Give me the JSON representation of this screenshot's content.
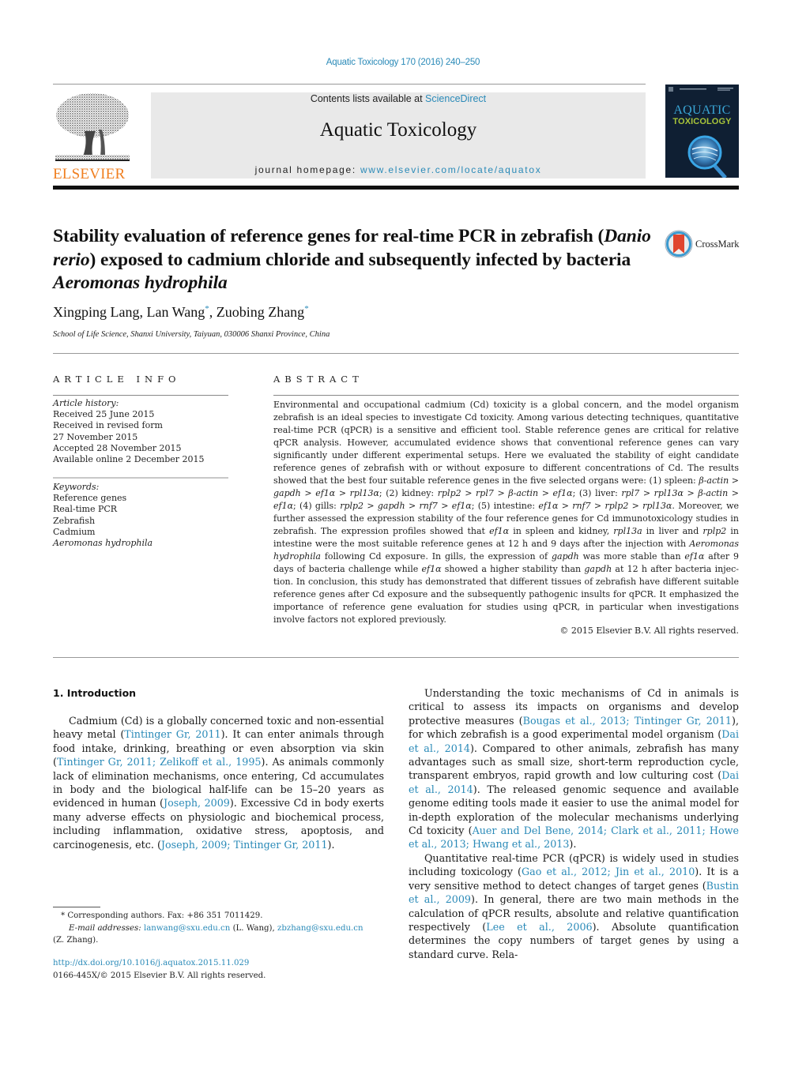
{
  "running_head": "Aquatic Toxicology 170 (2016) 240–250",
  "masthead": {
    "publisher_logo_text": "ELSEVIER",
    "contents_prefix": "Contents lists available at ",
    "contents_link": "ScienceDirect",
    "journal_title": "Aquatic Toxicology",
    "homepage_prefix": "journal homepage: ",
    "homepage_link": "www.elsevier.com/locate/aquatox",
    "cover_title_line1": "AQUATIC",
    "cover_title_line2": "TOXICOLOGY",
    "colors": {
      "link": "#2a8ab8",
      "elsevier_orange": "#f07f20",
      "cover_bg": "#0f1f33",
      "cover_green": "#a7c43a"
    }
  },
  "article": {
    "title_parts": [
      {
        "text": "Stability evaluation of reference genes for real-time PCR in zebrafish (",
        "italic": false
      },
      {
        "text": "Danio rerio",
        "italic": true
      },
      {
        "text": ") exposed to cadmium chloride and subsequently infected by bacteria ",
        "italic": false
      },
      {
        "text": "Aeromonas hydrophila",
        "italic": true
      }
    ],
    "crossmark_label": "CrossMark",
    "authors": [
      {
        "name": "Xingping Lang",
        "corresponding": false
      },
      {
        "name": "Lan Wang",
        "corresponding": true
      },
      {
        "name": "Zuobing Zhang",
        "corresponding": true
      }
    ],
    "affiliation": "School of Life Science, Shanxi University, Taiyuan, 030006 Shanxi Province, China"
  },
  "article_info": {
    "heading": "ARTICLE INFO",
    "history_label": "Article history:",
    "history": [
      "Received 25 June 2015",
      "Received in revised form",
      "27 November 2015",
      "Accepted 28 November 2015",
      "Available online 2 December 2015"
    ],
    "keywords_label": "Keywords:",
    "keywords": [
      {
        "text": "Reference genes",
        "italic": false
      },
      {
        "text": "Real-time PCR",
        "italic": false
      },
      {
        "text": "Zebrafish",
        "italic": false
      },
      {
        "text": "Cadmium",
        "italic": false
      },
      {
        "text": "Aeromonas hydrophila",
        "italic": true
      }
    ]
  },
  "abstract": {
    "heading": "ABSTRACT",
    "parts": [
      {
        "t": "Environmental and occupational cadmium (Cd) toxicity is a global concern, and the model organism zebrafish is an ideal species to investigate Cd toxicity. Among various detecting techniques, quan­titative real-time PCR (qPCR) is a sensitive and efficient tool. Stable reference genes are critical for relative qPCR analysis. However, accumulated evidence shows that conventional reference genes can vary significantly under different experimental setups. Here we evaluated the stability of eight can­didate reference genes of zebrafish with or without exposure to different concentrations of Cd. The results showed that the best four suitable reference genes in the five selected organs were: (1) spleen: "
      },
      {
        "t": "β-actin > gapdh > ef1α > rpl13α",
        "i": true
      },
      {
        "t": "; (2) kidney: "
      },
      {
        "t": "rplp2 > rpl7 > β-actin > ef1α",
        "i": true
      },
      {
        "t": "; (3) liver: "
      },
      {
        "t": "rpl7 > rpl13α > β-actin > ef1α",
        "i": true
      },
      {
        "t": "; (4) gills: "
      },
      {
        "t": "rplp2 > gapdh > rnf7 > ef1α",
        "i": true
      },
      {
        "t": "; (5) intestine: "
      },
      {
        "t": "ef1α > rnf7 > rplp2 > rpl13α",
        "i": true
      },
      {
        "t": ". Moreover, we further assessed the expression stability of the four reference genes for Cd immunotoxicology studies in zebrafish. The expression profiles showed that "
      },
      {
        "t": "ef1α",
        "i": true
      },
      {
        "t": " in spleen and kidney, "
      },
      {
        "t": "rpl13a",
        "i": true
      },
      {
        "t": " in liver and "
      },
      {
        "t": "rplp2",
        "i": true
      },
      {
        "t": " in intestine were the most suitable reference genes at 12 h and 9 days after the injection with "
      },
      {
        "t": "Aeromonas hydrophila",
        "i": true
      },
      {
        "t": " following Cd exposure. In gills, the expression of "
      },
      {
        "t": "gapdh",
        "i": true
      },
      {
        "t": " was more stable than "
      },
      {
        "t": "ef1α",
        "i": true
      },
      {
        "t": " after 9 days of bacteria challenge while "
      },
      {
        "t": "ef1α",
        "i": true
      },
      {
        "t": " showed a higher stability than "
      },
      {
        "t": "gapdh",
        "i": true
      },
      {
        "t": " at 12 h after bacteria injec­tion. In conclusion, this study has demonstrated that different tissues of zebrafish have different suitable reference genes after Cd exposure and the subsequently pathogenic insults for qPCR. It emphasized the importance of reference gene evaluation for studies using qPCR, in particular when investigations involve factors not explored previously."
      }
    ],
    "copyright": "© 2015 Elsevier B.V. All rights reserved."
  },
  "intro": {
    "heading": "1.  Introduction",
    "left_paragraphs": [
      [
        {
          "t": "Cadmium (Cd) is a globally concerned toxic and non-essential heavy metal ("
        },
        {
          "t": "Tintinger Gr, 2011",
          "l": true
        },
        {
          "t": "). It can enter animals through food intake, drinking, breathing or even absorption via skin ("
        },
        {
          "t": "Tintinger Gr, 2011; Zelikoff et al., 1995",
          "l": true
        },
        {
          "t": "). As animals commonly lack of elim­ination mechanisms, once entering, Cd accumulates in body and the biological half-life can be 15–20 years as evidenced in human ("
        },
        {
          "t": "Joseph, 2009",
          "l": true
        },
        {
          "t": "). Excessive Cd in body exerts many adverse effects on physiologic and biochemical process, including inflammation, oxidative stress, apoptosis, and carcinogenesis, etc. ("
        },
        {
          "t": "Joseph, 2009; Tintinger Gr, 2011",
          "l": true
        },
        {
          "t": ")."
        }
      ]
    ],
    "right_paragraphs": [
      [
        {
          "t": "Understanding the toxic mechanisms of Cd in animals is critical to assess its impacts on organisms and develop protective mea­sures ("
        },
        {
          "t": "Bougas et al., 2013; Tintinger Gr, 2011",
          "l": true
        },
        {
          "t": "), for which zebrafish is a good experimental model organism ("
        },
        {
          "t": "Dai et al., 2014",
          "l": true
        },
        {
          "t": "). Compared to other animals, zebrafish has many advantages such as small size, short-term reproduction cycle, transparent embryos, rapid growth and low culturing cost ("
        },
        {
          "t": "Dai et al., 2014",
          "l": true
        },
        {
          "t": "). The released genomic sequence and available genome editing tools made it easier to use the animal model for in-depth exploration of the molecular mecha­nisms underlying Cd toxicity ("
        },
        {
          "t": "Auer and Del Bene, 2014; Clark et al., 2011; Howe et al., 2013; Hwang et al., 2013",
          "l": true
        },
        {
          "t": ")."
        }
      ],
      [
        {
          "t": "Quantitative real-time PCR (qPCR) is widely used in studies including toxicology ("
        },
        {
          "t": "Gao et al., 2012; Jin et al., 2010",
          "l": true
        },
        {
          "t": "). It is a very sensitive method to detect changes of target genes ("
        },
        {
          "t": "Bustin et al., 2009",
          "l": true
        },
        {
          "t": "). In general, there are two main methods in the calculation of qPCR results, absolute and relative quantification respectively ("
        },
        {
          "t": "Lee et al., 2006",
          "l": true
        },
        {
          "t": "). Absolute quantification determines the copy numbers of target genes by using a standard curve. Rela-"
        }
      ]
    ]
  },
  "footnote": {
    "corresponding": "*  Corresponding authors. Fax: +86 351 7011429.",
    "email_label": "E-mail addresses:",
    "email1": "lanwang@sxu.edu.cn",
    "email1_owner": " (L. Wang), ",
    "email2": "zbzhang@sxu.edu.cn",
    "email2_owner": "(Z. Zhang).",
    "doi_link": "http://dx.doi.org/10.1016/j.aquatox.2015.11.029",
    "issn_line": "0166-445X/© 2015 Elsevier B.V. All rights reserved."
  }
}
